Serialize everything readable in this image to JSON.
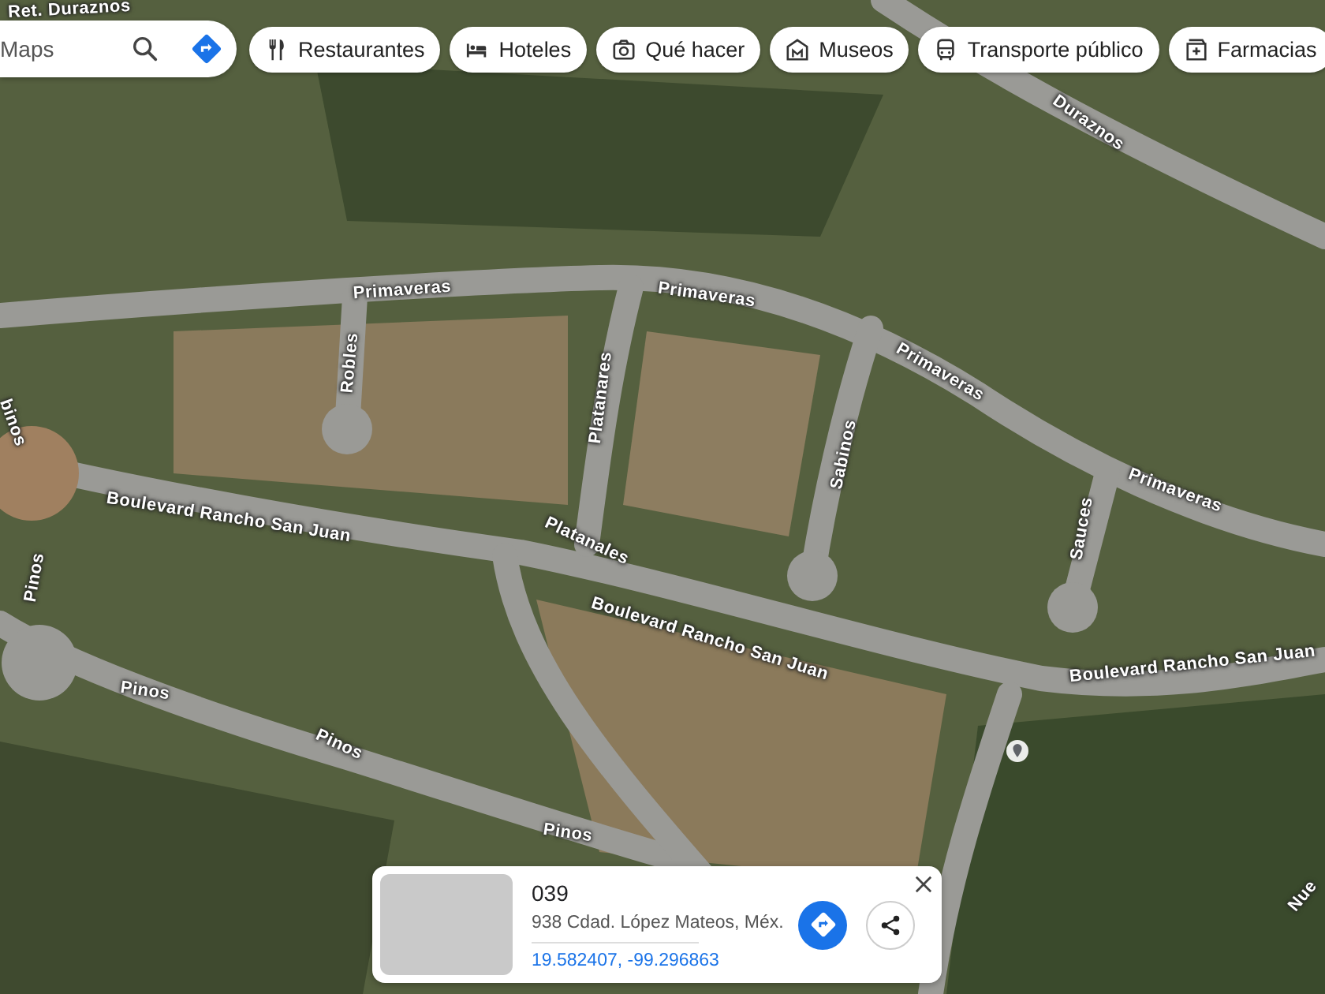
{
  "search": {
    "placeholder": "Maps"
  },
  "chips": [
    {
      "label": "Restaurantes",
      "kind": "restaurant"
    },
    {
      "label": "Hoteles",
      "kind": "hotel"
    },
    {
      "label": "Qué hacer",
      "kind": "camera"
    },
    {
      "label": "Museos",
      "kind": "museum"
    },
    {
      "label": "Transporte público",
      "kind": "transit"
    },
    {
      "label": "Farmacias",
      "kind": "pharmacy"
    }
  ],
  "map": {
    "street_labels": [
      "Ret. Duraznos",
      "Duraznos",
      "Primaveras",
      "Primaveras",
      "Primaveras",
      "Primaveras",
      "Robles",
      "Platanares",
      "Platanales",
      "Sabinos",
      "Sauces",
      "Boulevard Rancho San Juan",
      "Boulevard Rancho San Juan",
      "Boulevard Rancho San Juan",
      "Pinos",
      "Pinos",
      "Pinos",
      "Pinos",
      "binos",
      "Nue"
    ]
  },
  "place_card": {
    "title": "039",
    "address": "938 Cdad. López Mateos, Méx.",
    "coordinates": "19.582407, -99.296863"
  }
}
